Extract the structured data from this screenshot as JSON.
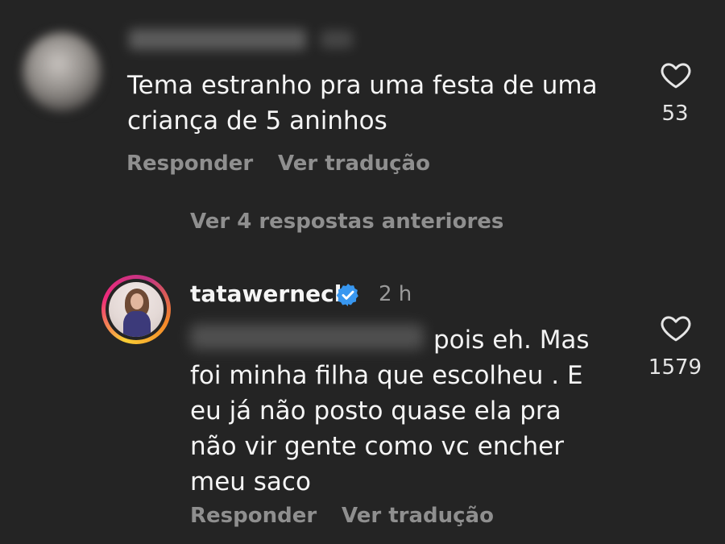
{
  "comments": [
    {
      "text_line1": "Tema estranho pra uma festa de uma",
      "text_line2": "criança de 5 aninhos",
      "likes": "53",
      "reply_label": "Responder",
      "translate_label": "Ver tradução"
    },
    {
      "username": "tatawerneck",
      "time": "2 h",
      "text_first": "pois eh. Mas",
      "text_rest": [
        "foi minha filha que escolheu . E",
        "eu já não posto quase ela pra",
        "não vir gente como vc encher",
        "meu saco"
      ],
      "likes": "1579",
      "reply_label": "Responder",
      "translate_label": "Ver tradução"
    }
  ],
  "view_previous_replies": "Ver 4 respostas anteriores",
  "colors": {
    "background": "#242424",
    "text": "#f5f5f5",
    "muted": "#8f8f8f",
    "verified": "#3897f0"
  },
  "icons": {
    "like": "heart-outline-icon",
    "verified": "verified-badge-icon"
  }
}
